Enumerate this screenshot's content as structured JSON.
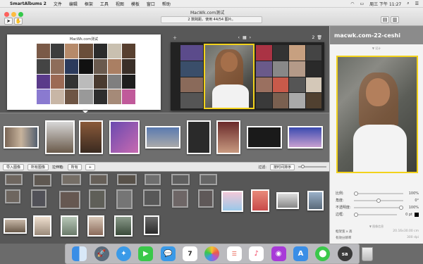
{
  "menubar": {
    "app_name": "SmartAlbums 2",
    "items": [
      "文件",
      "编辑",
      "框架",
      "工具",
      "视图",
      "模板",
      "窗口",
      "帮助"
    ],
    "clock": "周三 下午 11:27"
  },
  "window": {
    "title": "MacWk.com测试",
    "status": "2 数跨距。使用 44/54 图片。"
  },
  "spread": {
    "left_title": "MacWk.com测试",
    "page_number": "2"
  },
  "filterbar": {
    "import_label": "导入图像",
    "album_select": "所有图像",
    "sort_label": "拉伸箱:",
    "sort_select": "所有",
    "add_label": "+",
    "filter_label": "过滤:",
    "filter_select": "按时间排序"
  },
  "inspector": {
    "title": "macwk.com-22-ceshi",
    "section_design": "▼ 设计",
    "section_info": "▼ 图像信息",
    "sliders": [
      {
        "label": "比例:",
        "value": "100%",
        "fraction": 0
      },
      {
        "label": "角度:",
        "value": "0°",
        "fraction": 0.5
      },
      {
        "label": "不透明度:",
        "value": "100%",
        "fraction": 1
      },
      {
        "label": "边框:",
        "value": "0 pt",
        "fraction": 0
      }
    ],
    "info": [
      {
        "label": "框架宽 x 高",
        "value": "20.16x30.00 cm"
      },
      {
        "label": "有效分辨率",
        "value": "300 dpi"
      }
    ]
  },
  "colors": {
    "accent_yellow": "#f2d21b",
    "traffic_red": "#fc605c",
    "traffic_yellow": "#fdbc40",
    "traffic_green": "#34c84a"
  },
  "dock": {
    "icons": [
      "finder-icon",
      "launchpad-icon",
      "safari-icon",
      "facetime-icon",
      "messages-icon",
      "calendar-icon",
      "photos-icon",
      "reminders-icon",
      "music-icon",
      "podcasts-icon",
      "appstore-icon",
      "maps-icon",
      "smartalbums-icon"
    ],
    "calendar_day": "7",
    "trash": "trash-icon"
  }
}
